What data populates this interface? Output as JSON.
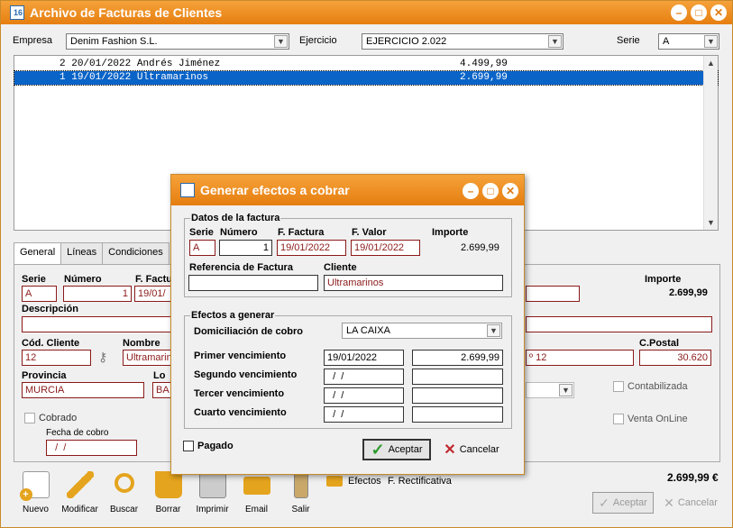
{
  "window": {
    "title": "Archivo de Facturas de Clientes"
  },
  "filters": {
    "empresa_label": "Empresa",
    "empresa_value": "Denim Fashion S.L.",
    "ejercicio_label": "Ejercicio",
    "ejercicio_value": "EJERCICIO 2.022",
    "serie_label": "Serie",
    "serie_value": "A"
  },
  "invoices": [
    {
      "num": "2",
      "date": "20/01/2022",
      "client": "Andrés Jiménez",
      "amount": "4.499,99"
    },
    {
      "num": "1",
      "date": "19/01/2022",
      "client": "Ultramarinos",
      "amount": "2.699,99"
    }
  ],
  "tabs": [
    "General",
    "Líneas",
    "Condiciones"
  ],
  "form": {
    "serie_label": "Serie",
    "serie": "A",
    "numero_label": "Número",
    "numero": "1",
    "ffactura_label": "F. Factu",
    "ffactura": "19/01/",
    "importe_label": "Importe",
    "importe": "2.699,99",
    "descripcion_label": "Descripción",
    "codcliente_label": "Cód. Cliente",
    "codcliente": "12",
    "nombre_label": "Nombre",
    "nombre": "Ultramarin",
    "direccion_tail": "º 12",
    "cpostal_label": "C.Postal",
    "cpostal": "30.620",
    "provincia_label": "Provincia",
    "provincia": "MURCIA",
    "localidad_label": "Lo",
    "localidad": "BA",
    "cobrado_label": "Cobrado",
    "fechacobro_label": "Fecha de cobro",
    "fechacobro": "  /  /",
    "contabilizada_label": "Contabilizada",
    "ventaonline_label": "Venta OnLine"
  },
  "toolbar": [
    "Nuevo",
    "Modificar",
    "Buscar",
    "Borrar",
    "Imprimir",
    "Email",
    "Salir"
  ],
  "links": {
    "efectos": "Efectos",
    "rectificativa": "F. Rectificativa"
  },
  "total": "2.699,99 €",
  "main_buttons": {
    "aceptar": "Aceptar",
    "cancelar": "Cancelar"
  },
  "dialog": {
    "title": "Generar efectos a cobrar",
    "datos_title": "Datos de la factura",
    "serie_label": "Serie",
    "serie": "A",
    "numero_label": "Número",
    "numero": "1",
    "ffactura_label": "F. Factura",
    "ffactura": "19/01/2022",
    "fvalor_label": "F. Valor",
    "fvalor": "19/01/2022",
    "importe_label": "Importe",
    "importe": "2.699,99",
    "referencia_label": "Referencia de Factura",
    "referencia": "",
    "cliente_label": "Cliente",
    "cliente": "Ultramarinos",
    "efectos_title": "Efectos a generar",
    "domiciliacion_label": "Domiciliación de cobro",
    "domiciliacion": "LA CAIXA",
    "venc": [
      {
        "label": "Primer vencimiento",
        "date": "19/01/2022",
        "amount": "2.699,99"
      },
      {
        "label": "Segundo vencimiento",
        "date": "  /  /",
        "amount": ""
      },
      {
        "label": "Tercer vencimiento",
        "date": "  /  /",
        "amount": ""
      },
      {
        "label": "Cuarto vencimiento",
        "date": "  /  /",
        "amount": ""
      }
    ],
    "pagado_label": "Pagado",
    "aceptar": "Aceptar",
    "cancelar": "Cancelar"
  }
}
